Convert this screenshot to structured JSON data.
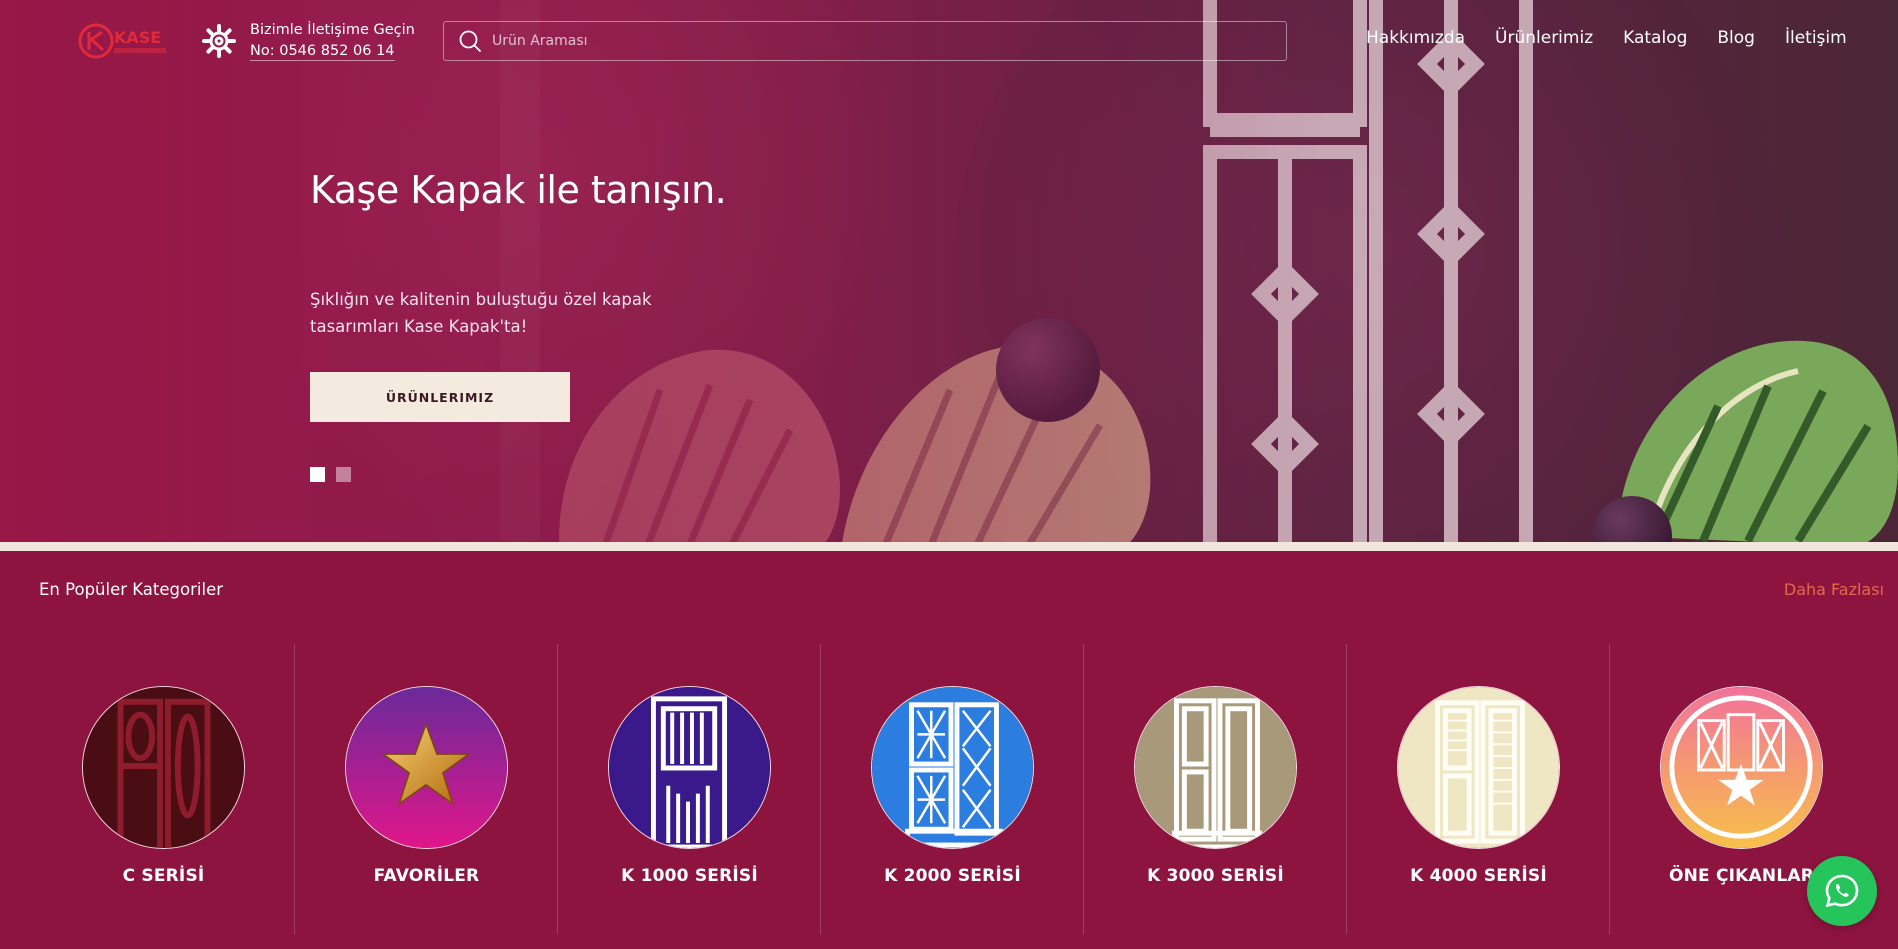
{
  "header": {
    "logo_text": "KASE",
    "contact_line1": "Bizimle İletişime Geçin",
    "contact_phone": "No: 0546 852 06 14",
    "search_placeholder": "Ürün Araması",
    "nav": [
      {
        "label": "Hakkımızda"
      },
      {
        "label": "Ürünlerimiz"
      },
      {
        "label": "Katalog"
      },
      {
        "label": "Blog"
      },
      {
        "label": "İletişim"
      }
    ]
  },
  "hero": {
    "title": "Kaşe Kapak ile tanışın.",
    "subtitle": "Şıklığın ve kalitenin buluştuğu özel kapak tasarımları Kase Kapak'ta!",
    "button_label": "ÜRÜNLERIMIZ",
    "slides": {
      "count": 2,
      "active": 1
    }
  },
  "categories": {
    "title": "En Popüler Kategoriler",
    "more_label": "Daha Fazlası",
    "items": [
      {
        "label": "C SERİSİ",
        "color": "#4a0d14"
      },
      {
        "label": "FAVORİLER",
        "color": "#b0208a"
      },
      {
        "label": "K 1000 SERİSİ",
        "color": "#3a1a8a"
      },
      {
        "label": "K 2000 SERİSİ",
        "color": "#2b7ee0"
      },
      {
        "label": "K 3000 SERİSİ",
        "color": "#a8997a"
      },
      {
        "label": "K 4000 SERİSİ",
        "color": "#efe6c4"
      },
      {
        "label": "ÖNE ÇIKANLAR",
        "color": "#f5a070"
      }
    ]
  },
  "colors": {
    "brand": "#8e1440",
    "accent_link": "#e06a4a",
    "whatsapp": "#25c55c"
  }
}
